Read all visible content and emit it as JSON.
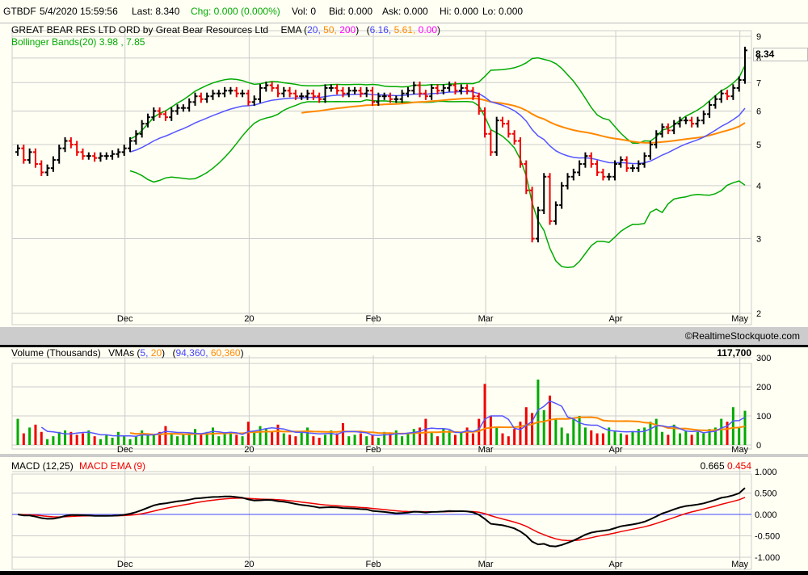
{
  "header": {
    "symbol": "GTBDF",
    "datetime": "5/4/2020 15:59:56",
    "last": "Last: 8.340",
    "chg": "Chg: 0.000 (0.000%)",
    "vol": "Vol: 0",
    "bid": "Bid: 0.000",
    "ask": "Ask: 0.000",
    "hi": "Hi: 0.000",
    "lo": "Lo: 0.000"
  },
  "price_pane": {
    "title": "GREAT BEAR RES LTD ORD by Great Bear Resources Ltd",
    "ema_label": "EMA (",
    "ema_periods": [
      "20,",
      "50,",
      "200"
    ],
    "ema_close": ")",
    "ema_values_open": "(",
    "ema_values": [
      "6.16,",
      "5.61,",
      "0.00"
    ],
    "ema_values_close": ")",
    "bollinger": "Bollinger Bands(20) 3.98 , 7.85",
    "last_price_box": "8.34",
    "yticks": [
      "9",
      "8",
      "7",
      "6",
      "5",
      "4",
      "3",
      "2"
    ]
  },
  "volume_pane": {
    "title": "Volume (Thousands)",
    "vma_label": "VMAs (",
    "vma_periods": [
      "5,",
      "20"
    ],
    "vma_close": ")",
    "vma_values_open": "(",
    "vma_values": [
      "94,360,",
      "60,360"
    ],
    "vma_values_close": ")",
    "last_volume": "117,700",
    "yticks": [
      "300",
      "200",
      "100",
      "0"
    ]
  },
  "macd_pane": {
    "title": "MACD (12,25)",
    "signal_title": "MACD EMA (9)",
    "macd_value": "0.665",
    "signal_value": "0.454",
    "yticks": [
      "1.000",
      "0.500",
      "0.000",
      "-0.500",
      "-1.000"
    ]
  },
  "xaxis": {
    "labels": [
      "Dec",
      "20",
      "Feb",
      "Mar",
      "Apr",
      "May"
    ],
    "label_bar_index": [
      18,
      39,
      60,
      79,
      101,
      122
    ]
  },
  "copyright": "©RealtimeStockquote.com",
  "colors": {
    "up": "#000000",
    "down": "#ee0000",
    "vol_up": "#00aa00",
    "vol_down": "#ee0000",
    "ema20": "#5555ff",
    "ema50": "#ff8800",
    "ema200": "#ff00ff",
    "bollinger": "#00aa00",
    "macd": "#000000",
    "signal": "#ee0000",
    "zero": "#4444ff",
    "grid": "#cccccc"
  },
  "chart_data": {
    "type": "ohlc",
    "scale": "log",
    "ylim": [
      2,
      9
    ],
    "close": [
      4.9,
      4.6,
      4.8,
      4.5,
      4.3,
      4.4,
      4.6,
      4.9,
      5.1,
      5.0,
      4.8,
      4.7,
      4.7,
      4.65,
      4.7,
      4.7,
      4.75,
      4.8,
      4.9,
      5.1,
      5.3,
      5.6,
      5.8,
      6.0,
      5.9,
      5.8,
      6.0,
      6.1,
      6.1,
      6.3,
      6.5,
      6.4,
      6.5,
      6.6,
      6.6,
      6.7,
      6.7,
      6.6,
      6.6,
      6.3,
      6.4,
      6.8,
      6.9,
      6.8,
      6.6,
      6.7,
      6.6,
      6.5,
      6.5,
      6.6,
      6.5,
      6.4,
      6.8,
      6.8,
      6.7,
      6.6,
      6.7,
      6.7,
      6.6,
      6.7,
      6.3,
      6.5,
      6.5,
      6.4,
      6.4,
      6.6,
      6.7,
      6.9,
      6.6,
      6.5,
      6.8,
      6.7,
      6.8,
      6.9,
      6.7,
      6.8,
      6.7,
      6.5,
      6.0,
      5.3,
      4.8,
      5.7,
      5.6,
      5.3,
      5.1,
      4.5,
      3.9,
      3.0,
      3.5,
      4.2,
      3.3,
      3.6,
      4.0,
      4.2,
      4.3,
      4.5,
      4.7,
      4.5,
      4.3,
      4.2,
      4.2,
      4.5,
      4.6,
      4.4,
      4.4,
      4.5,
      4.7,
      5.0,
      5.3,
      5.5,
      5.4,
      5.6,
      5.7,
      5.7,
      5.6,
      5.7,
      5.9,
      6.2,
      6.4,
      6.6,
      6.5,
      6.8,
      7.1,
      8.34
    ],
    "volume_thousands": [
      90,
      40,
      60,
      70,
      45,
      20,
      30,
      45,
      50,
      45,
      35,
      40,
      50,
      30,
      20,
      35,
      25,
      45,
      30,
      20,
      30,
      50,
      40,
      35,
      45,
      65,
      40,
      30,
      35,
      40,
      55,
      35,
      45,
      60,
      30,
      40,
      45,
      35,
      30,
      80,
      50,
      65,
      55,
      45,
      70,
      40,
      35,
      30,
      45,
      60,
      30,
      25,
      35,
      50,
      40,
      75,
      30,
      35,
      40,
      30,
      35,
      25,
      45,
      40,
      50,
      30,
      40,
      55,
      60,
      90,
      45,
      30,
      55,
      50,
      35,
      45,
      60,
      40,
      90,
      210,
      100,
      60,
      40,
      30,
      55,
      80,
      130,
      110,
      225,
      120,
      170,
      90,
      60,
      40,
      90,
      100,
      60,
      50,
      40,
      40,
      60,
      50,
      40,
      35,
      45,
      55,
      60,
      80,
      90,
      45,
      35,
      70,
      40,
      50,
      35,
      45,
      40,
      55,
      60,
      90,
      80,
      130,
      60,
      117.7
    ],
    "volume_ylim": [
      0,
      300
    ],
    "macd_ylim": [
      -1,
      1
    ],
    "indicators": {
      "ema": [
        20,
        50,
        200
      ],
      "bollinger": 20,
      "vma": [
        5,
        20
      ],
      "macd": [
        12,
        25,
        9
      ]
    }
  }
}
